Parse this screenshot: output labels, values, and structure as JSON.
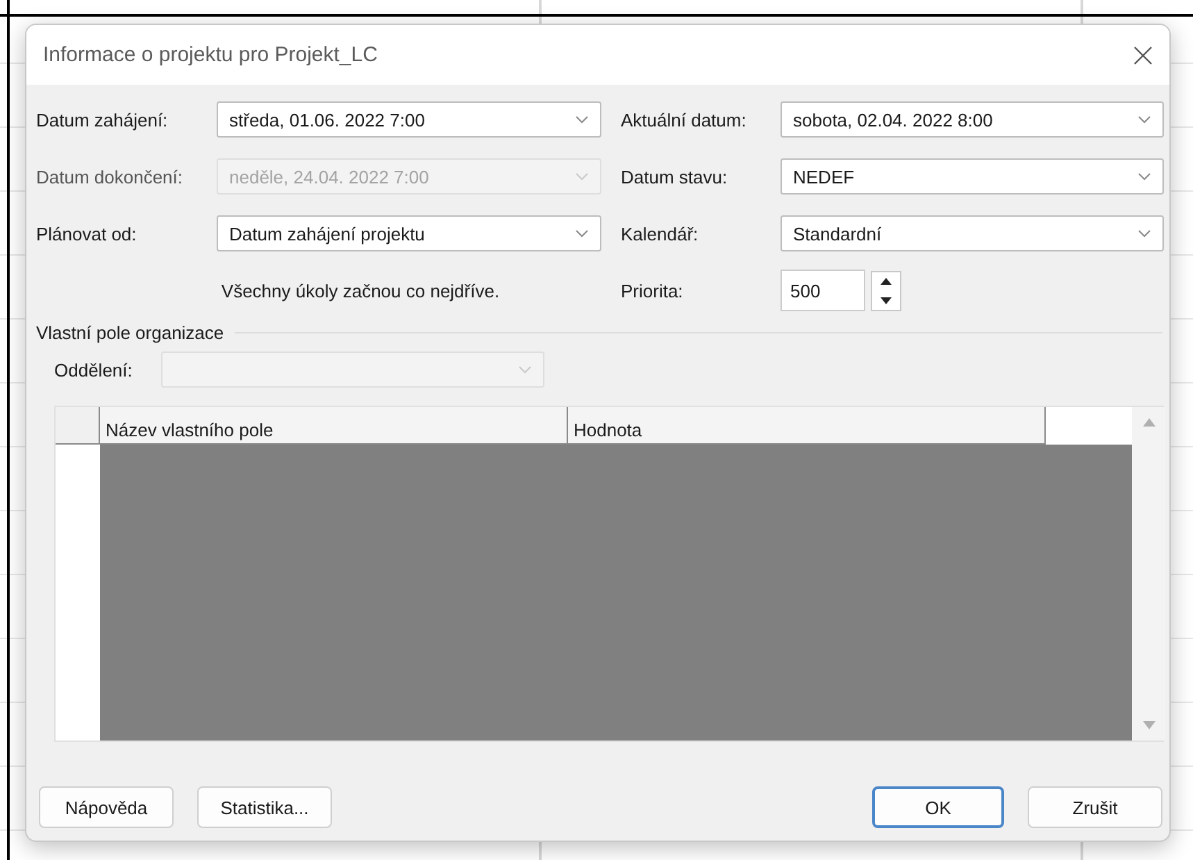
{
  "window": {
    "title": "Informace o projektu pro Projekt_LC"
  },
  "left_fields": [
    {
      "label": "Datum zahájení:",
      "value": "středa, 01.06. 2022 7:00",
      "disabled": false
    },
    {
      "label": "Datum dokončení:",
      "value": "neděle, 24.04. 2022 7:00",
      "disabled": true
    },
    {
      "label": "Plánovat od:",
      "value": "Datum zahájení projektu",
      "disabled": false
    }
  ],
  "right_fields": [
    {
      "label": "Aktuální datum:",
      "value": "sobota, 02.04. 2022 8:00",
      "disabled": false
    },
    {
      "label": "Datum stavu:",
      "value": "NEDEF",
      "disabled": false
    },
    {
      "label": "Kalendář:",
      "value": "Standardní",
      "disabled": false
    }
  ],
  "schedule_note": "Všechny úkoly začnou co nejdříve.",
  "priority": {
    "label": "Priorita:",
    "value": "500"
  },
  "custom_fields": {
    "title": "Vlastní pole organizace",
    "department": {
      "label": "Oddělení:",
      "disabled": true
    },
    "columns": [
      "Název vlastního pole",
      "Hodnota"
    ]
  },
  "buttons": [
    {
      "label": "Nápověda",
      "default": false
    },
    {
      "label": "Statistika...",
      "default": false
    },
    {
      "label": "OK",
      "default": true
    },
    {
      "label": "Zrušit",
      "default": false
    }
  ]
}
